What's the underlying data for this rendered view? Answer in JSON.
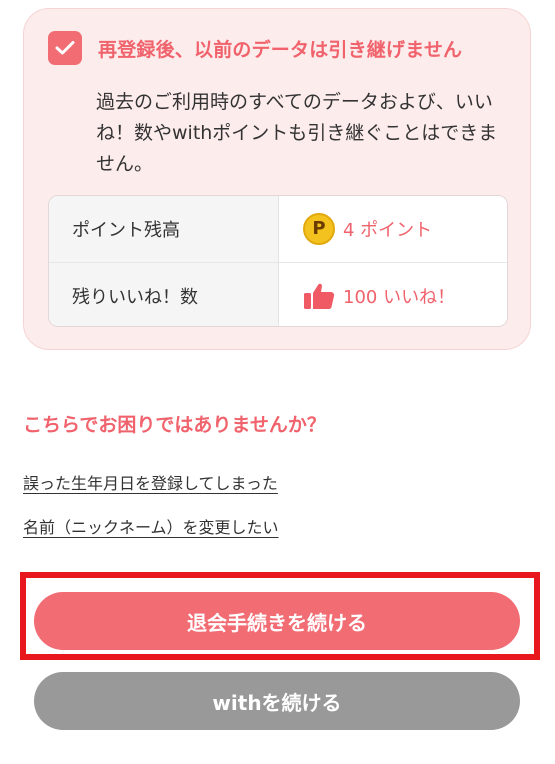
{
  "notice": {
    "checkbox_checked": true,
    "title": "再登録後、以前のデータは引き継げません",
    "description": "過去のご利用時のすべてのデータおよび、いいね！数やwithポイントも引き継ぐことはできません。"
  },
  "info_table": {
    "points": {
      "label": "ポイント残高",
      "coin_letter": "P",
      "value": "4 ポイント"
    },
    "likes": {
      "label": "残りいいね！数",
      "value": "100 いいね！"
    }
  },
  "help": {
    "heading": "こちらでお困りではありませんか？",
    "links": [
      "誤った生年月日を登録してしまった",
      "名前（ニックネーム）を変更したい"
    ]
  },
  "buttons": {
    "continue_withdrawal": "退会手続きを続ける",
    "continue_with": "withを続ける"
  },
  "colors": {
    "accent": "#f0636c",
    "card_background": "#fdecec",
    "highlight_border": "#e8161d",
    "secondary_button": "#999999"
  },
  "icons": {
    "checkbox": "checkmark-icon",
    "points": "coin-icon",
    "likes": "thumbs-up-icon"
  }
}
